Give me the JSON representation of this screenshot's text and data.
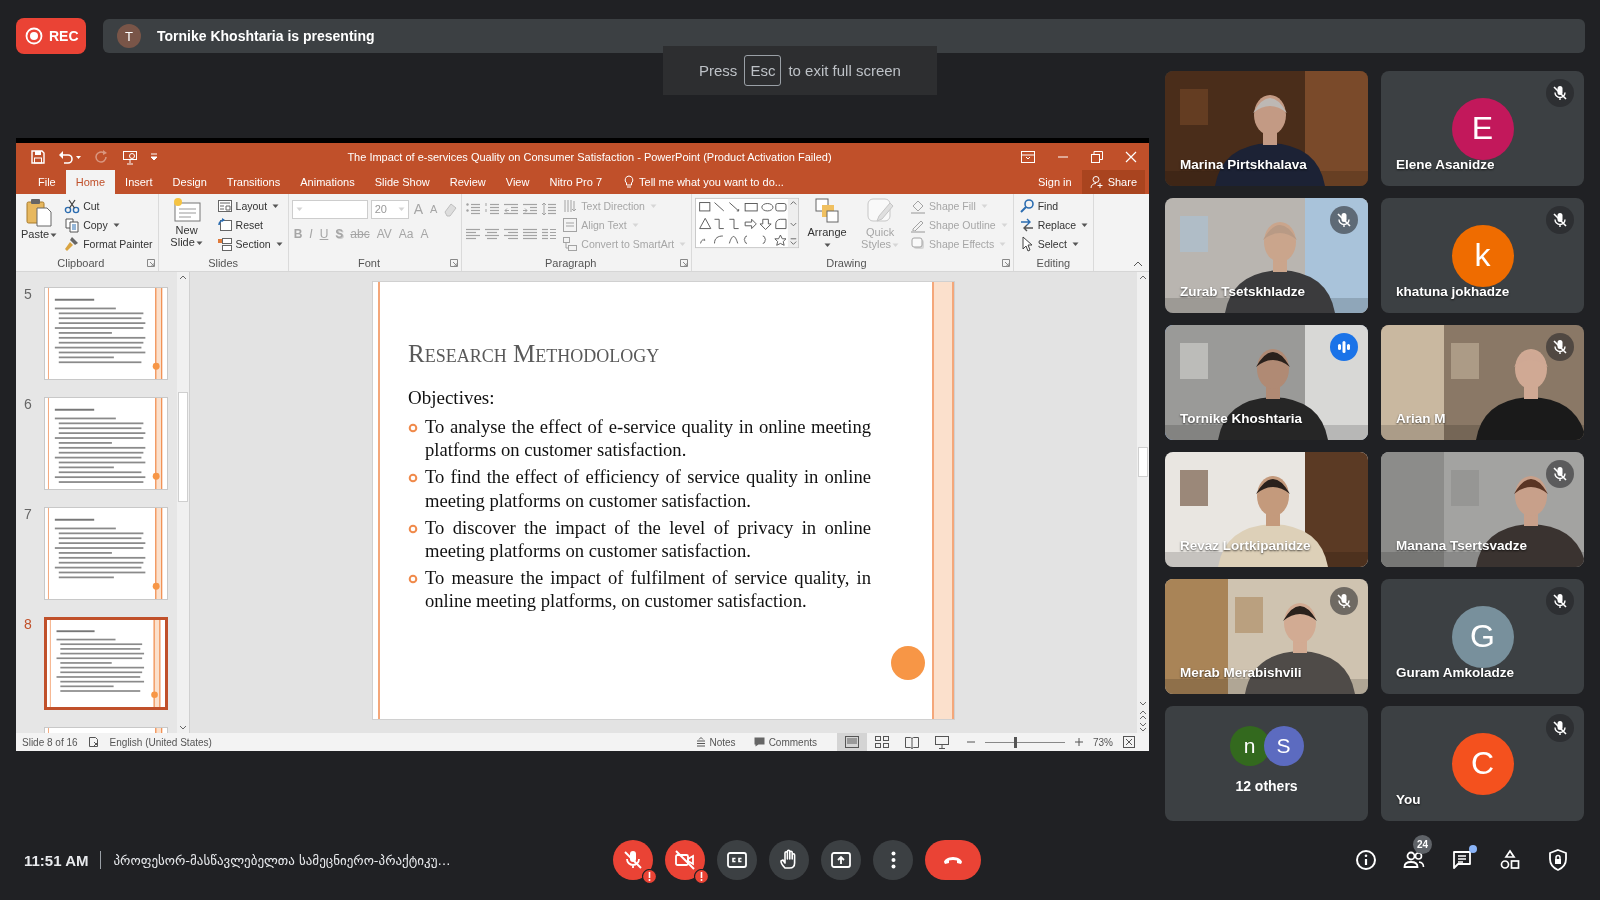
{
  "rec": {
    "label": "REC"
  },
  "presenter": {
    "initial": "T",
    "text": "Tornike Khoshtaria is presenting"
  },
  "toast": {
    "before": "Press",
    "key": "Esc",
    "after": "to exit full screen"
  },
  "ppt": {
    "title": "The Impact of e-services Quality on Consumer Satisfaction - PowerPoint (Product Activation Failed)",
    "quick_access": [
      {
        "disabled": false
      },
      {
        "disabled": false
      },
      {
        "disabled": true
      },
      {
        "disabled": false
      }
    ],
    "tabs": [
      {
        "label": "File",
        "selected": false
      },
      {
        "label": "Home",
        "selected": true
      },
      {
        "label": "Insert",
        "selected": false
      },
      {
        "label": "Design",
        "selected": false
      },
      {
        "label": "Transitions",
        "selected": false
      },
      {
        "label": "Animations",
        "selected": false
      },
      {
        "label": "Slide Show",
        "selected": false
      },
      {
        "label": "Review",
        "selected": false
      },
      {
        "label": "View",
        "selected": false
      },
      {
        "label": "Nitro Pro 7",
        "selected": false
      }
    ],
    "tell_me": "Tell me what you want to do...",
    "sign_in": "Sign in",
    "share": "Share",
    "ribbon": [
      {
        "label": "Clipboard",
        "launcher": true,
        "items": [
          {
            "kind": "large",
            "label": "Paste",
            "menu": true,
            "disabled": false
          },
          {
            "kind": "small",
            "label": "Cut",
            "menu": false,
            "disabled": false
          },
          {
            "kind": "small",
            "label": "Copy",
            "menu": true,
            "disabled": false
          },
          {
            "kind": "small",
            "label": "Format Painter",
            "menu": false,
            "disabled": false
          }
        ]
      },
      {
        "label": "Slides",
        "launcher": false,
        "items": [
          {
            "kind": "large",
            "label": "New Slide",
            "menu": true,
            "disabled": false
          },
          {
            "kind": "small",
            "label": "Layout",
            "menu": true,
            "disabled": false
          },
          {
            "kind": "small",
            "label": "Reset",
            "menu": false,
            "disabled": false
          },
          {
            "kind": "small",
            "label": "Section",
            "menu": true,
            "disabled": false
          }
        ]
      },
      {
        "label": "Font",
        "launcher": true,
        "items": [
          {
            "kind": "toolrow",
            "disabled": true,
            "tools": [
              {
                "kind": "field"
              },
              {
                "kind": "field",
                "value": "20"
              },
              {
                "kind": "glyph",
                "label": "A"
              },
              {
                "kind": "glyph",
                "label": "A"
              },
              {
                "kind": "icon"
              }
            ]
          },
          {
            "kind": "toolrow",
            "disabled": true,
            "tools": [
              {
                "kind": "glyph",
                "label": "B"
              },
              {
                "kind": "glyph",
                "label": "I"
              },
              {
                "kind": "glyph",
                "label": "U"
              },
              {
                "kind": "glyph",
                "label": "S"
              },
              {
                "kind": "glyph",
                "label": "abc"
              },
              {
                "kind": "glyph",
                "label": "AV"
              },
              {
                "kind": "glyph",
                "label": "Aa"
              },
              {
                "kind": "glyph",
                "label": "A"
              }
            ]
          }
        ]
      },
      {
        "label": "Paragraph",
        "launcher": true,
        "items": [
          {
            "kind": "toolrow",
            "disabled": true,
            "tools": [
              {
                "kind": "icon"
              },
              {
                "kind": "icon"
              },
              {
                "kind": "icon"
              },
              {
                "kind": "icon"
              },
              {
                "kind": "icon"
              }
            ]
          },
          {
            "kind": "toolrow",
            "disabled": true,
            "tools": [
              {
                "kind": "icon"
              },
              {
                "kind": "icon"
              },
              {
                "kind": "icon"
              },
              {
                "kind": "icon"
              },
              {
                "kind": "icon"
              }
            ]
          },
          {
            "kind": "small",
            "label": "Text Direction",
            "menu": true,
            "disabled": true
          },
          {
            "kind": "small",
            "label": "Align Text",
            "menu": true,
            "disabled": true
          },
          {
            "kind": "small",
            "label": "Convert to SmartArt",
            "menu": true,
            "disabled": true
          }
        ]
      },
      {
        "label": "Drawing",
        "launcher": true,
        "items": [
          {
            "kind": "gallery"
          },
          {
            "kind": "large",
            "label": "Arrange",
            "menu": true,
            "disabled": false
          },
          {
            "kind": "large",
            "label": "Quick Styles",
            "menu": true,
            "disabled": true
          },
          {
            "kind": "small",
            "label": "Shape Fill",
            "menu": true,
            "disabled": true
          },
          {
            "kind": "small",
            "label": "Shape Outline",
            "menu": true,
            "disabled": true
          },
          {
            "kind": "small",
            "label": "Shape Effects",
            "menu": true,
            "disabled": true
          }
        ]
      },
      {
        "label": "Editing",
        "launcher": false,
        "items": [
          {
            "kind": "small",
            "label": "Find",
            "menu": false,
            "disabled": false
          },
          {
            "kind": "small",
            "label": "Replace",
            "menu": true,
            "disabled": false
          },
          {
            "kind": "small",
            "label": "Select",
            "menu": true,
            "disabled": false
          }
        ]
      }
    ],
    "thumbnails": [
      {
        "number": "5",
        "selected": false
      },
      {
        "number": "6",
        "selected": false
      },
      {
        "number": "7",
        "selected": false
      },
      {
        "number": "8",
        "selected": true
      },
      {
        "selected": false
      }
    ],
    "slide": {
      "title": "Research Methodology",
      "heading": "Objectives:",
      "bullets": [
        "To analyse the effect of e-service quality in online meeting platforms on customer satisfaction.",
        "To find the effect of efficiency of service quality in online meeting platforms on customer satisfaction.",
        "To discover the impact of the level of privacy in online meeting platforms on customer satisfaction.",
        "To measure the impact of fulfilment of service quality, in online meeting platforms, on customer satisfaction."
      ]
    },
    "status": {
      "slide": "Slide 8 of 16",
      "language": "English (United States)",
      "notes": "Notes",
      "comments": "Comments",
      "views": [
        {
          "selected": true
        },
        {
          "selected": false
        },
        {
          "selected": false
        },
        {
          "selected": false
        }
      ],
      "zoom_slider": {
        "level": 0.37
      },
      "zoom": "73%"
    }
  },
  "tiles": [
    {
      "kind": "video",
      "name": "Marina Pirtskhalava",
      "muted": false,
      "speaking": false
    },
    {
      "kind": "avatar",
      "name": "Elene Asanidze",
      "initial": "E",
      "color": "#c2185b",
      "muted": true,
      "speaking": false
    },
    {
      "kind": "video",
      "name": "Zurab Tsetskhladze",
      "muted": true,
      "speaking": false
    },
    {
      "kind": "avatar",
      "name": "khatuna jokhadze",
      "initial": "k",
      "color": "#ef6c00",
      "muted": true,
      "speaking": false
    },
    {
      "kind": "video",
      "name": "Tornike Khoshtaria",
      "muted": false,
      "speaking": true
    },
    {
      "kind": "video",
      "name": "Arian M",
      "muted": true,
      "speaking": false
    },
    {
      "kind": "video",
      "name": "Revaz Lortkipanidze",
      "muted": false,
      "speaking": false
    },
    {
      "kind": "video",
      "name": "Manana Tsertsvadze",
      "muted": true,
      "speaking": false
    },
    {
      "kind": "video",
      "name": "Merab Merabishvili",
      "muted": true,
      "speaking": false
    },
    {
      "kind": "avatar",
      "name": "Guram Amkoladze",
      "initial": "G",
      "color": "#78909c",
      "muted": true,
      "speaking": false
    },
    {
      "kind": "others",
      "label": "12 others",
      "avatars": [
        {
          "initial": "n",
          "color": "#33691e"
        },
        {
          "initial": "S",
          "color": "#5c6bc0"
        }
      ],
      "muted": false,
      "speaking": false
    },
    {
      "kind": "avatar",
      "name": "You",
      "initial": "C",
      "color": "#f4511e",
      "muted": true,
      "speaking": false
    }
  ],
  "bottom": {
    "time": "11:51 AM",
    "meeting": "პროფესორ-მასწავლებელთა სამეცნიერო-პრაქტიკუ…",
    "controls": [
      {
        "kind": "mic",
        "on": false,
        "alert": true
      },
      {
        "kind": "camera",
        "on": false,
        "alert": true
      },
      {
        "kind": "captions",
        "on": false,
        "alert": false
      },
      {
        "kind": "hand",
        "on": false,
        "alert": false
      },
      {
        "kind": "present",
        "on": false,
        "alert": false
      },
      {
        "kind": "more",
        "alert": false
      },
      {
        "kind": "hangup",
        "alert": false
      }
    ],
    "right": [
      {
        "kind": "info"
      },
      {
        "kind": "people",
        "badge": "24"
      },
      {
        "kind": "chat",
        "unread": true
      },
      {
        "kind": "activities"
      },
      {
        "kind": "safety"
      }
    ]
  }
}
